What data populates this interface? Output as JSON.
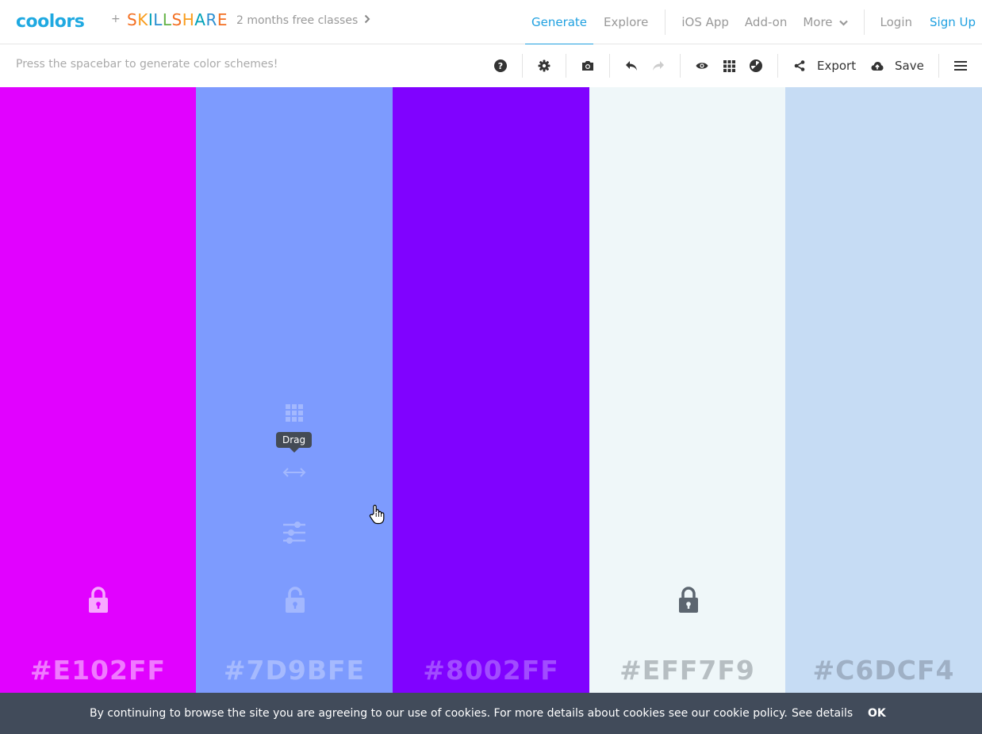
{
  "header": {
    "logo_text": "coolors",
    "plus": "+",
    "partner_logo": "SKILLSHARE",
    "promo_text": "2 months free classes",
    "nav": {
      "generate": "Generate",
      "explore": "Explore",
      "ios_app": "iOS App",
      "addon": "Add-on",
      "more": "More",
      "login": "Login",
      "signup": "Sign Up"
    }
  },
  "toolbar": {
    "hint": "Press the spacebar to generate color schemes!",
    "export_label": "Export",
    "save_label": "Save",
    "icons": [
      "help-icon",
      "gear-icon",
      "camera-icon",
      "undo-icon",
      "redo-icon",
      "eye-icon",
      "grid-icon",
      "contrast-icon",
      "share-icon",
      "cloud-upload-icon",
      "menu-icon"
    ]
  },
  "palette": {
    "colors": [
      {
        "hex": "#E102FF",
        "bg": "#e102ff",
        "text_color": "#f07aff",
        "locked": true
      },
      {
        "hex": "#7D9BFE",
        "bg": "#7d9bfe",
        "text_color": "#a6bafe",
        "locked": false
      },
      {
        "hex": "#8002FF",
        "bg": "#8002ff",
        "text_color": "#a14cff",
        "locked": false
      },
      {
        "hex": "#EFF7F9",
        "bg": "#eff7f9",
        "text_color": "#b6bec2",
        "locked": true
      },
      {
        "hex": "#C6DCF4",
        "bg": "#c6dcf4",
        "text_color": "#9fb0c5",
        "locked": false
      }
    ],
    "hover_tooltip": "Drag"
  },
  "cookie": {
    "text": "By continuing to browse the site you are agreeing to our use of cookies. For more details about cookies see our cookie policy.",
    "details": "See details",
    "ok": "OK"
  },
  "colors": {
    "accent": "#1fa0e0",
    "cookie_bg": "#414b5a"
  }
}
